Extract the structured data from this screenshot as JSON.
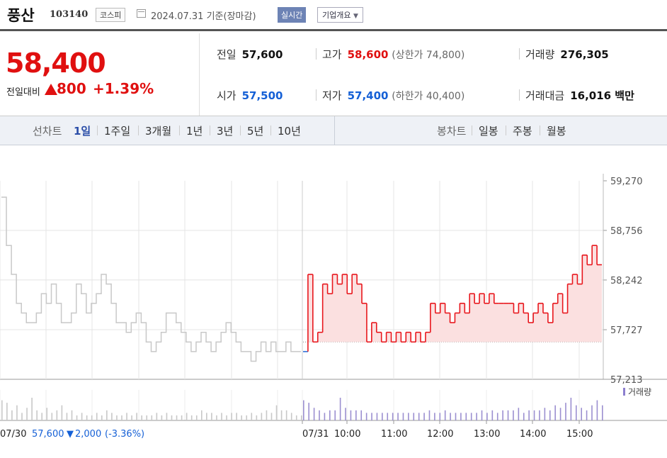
{
  "header": {
    "name": "풍산",
    "code": "103140",
    "market": "코스피",
    "date": "2024.07.31",
    "basis": "기준(장마감)",
    "realtime_btn": "실시간",
    "company_btn": "기업개요",
    "calendar_icon": "calendar-icon"
  },
  "price": {
    "current": "58,400",
    "diff_label": "전일대비",
    "diff_value": "800",
    "diff_pct": "+1.39%"
  },
  "stats": {
    "prev_label": "전일",
    "prev_value": "57,600",
    "open_label": "시가",
    "open_value": "57,500",
    "high_label": "고가",
    "high_value": "58,600",
    "upper_limit": "(상한가 74,800)",
    "low_label": "저가",
    "low_value": "57,400",
    "lower_limit": "(하한가 40,400)",
    "volume_label": "거래량",
    "volume_value": "276,305",
    "amount_label": "거래대금",
    "amount_value": "16,016 백만"
  },
  "periods": {
    "line_label": "선차트",
    "items": [
      "1일",
      "1주일",
      "3개월",
      "1년",
      "3년",
      "5년",
      "10년"
    ],
    "selected": "1일",
    "candle_label": "봉차트",
    "candle_items": [
      "일봉",
      "주봉",
      "월봉"
    ]
  },
  "chart_data": {
    "type": "line",
    "y_ticks": [
      "59,270",
      "58,756",
      "58,242",
      "57,727",
      "57,213"
    ],
    "ylim": [
      57213,
      59270
    ],
    "x_ticks": [
      "07/31",
      "10:00",
      "11:00",
      "12:00",
      "13:00",
      "14:00",
      "15:00"
    ],
    "baseline": 57600,
    "volume_legend": "거래량",
    "prev_day": {
      "date": "07/30",
      "close": "57,600",
      "change": "2,000",
      "change_pct": "(-3.36%)",
      "values": [
        59100,
        58600,
        58300,
        58000,
        57900,
        57800,
        57800,
        57900,
        58100,
        58000,
        58200,
        58000,
        57800,
        57800,
        57900,
        58200,
        58100,
        57900,
        58000,
        58100,
        58300,
        58200,
        58000,
        57800,
        57800,
        57700,
        57800,
        57900,
        57800,
        57600,
        57500,
        57600,
        57700,
        57900,
        57900,
        57800,
        57700,
        57600,
        57500,
        57600,
        57700,
        57600,
        57500,
        57600,
        57700,
        57800,
        57700,
        57600,
        57500,
        57500,
        57400,
        57500,
        57600,
        57500,
        57600,
        57500,
        57500,
        57600,
        57500,
        57500,
        57500
      ]
    },
    "series": [
      {
        "values": [
          57500,
          58300,
          57600,
          57700,
          58200,
          58100,
          58300,
          58200,
          58300,
          58100,
          58300,
          58200,
          58000,
          57600,
          57800,
          57700,
          57600,
          57700,
          57600,
          57700,
          57600,
          57700,
          57600,
          57700,
          57600,
          57700,
          58000,
          57900,
          58000,
          57900,
          57800,
          57900,
          58000,
          57900,
          58100,
          58000,
          58100,
          58000,
          58100,
          58000,
          58000,
          58000,
          58000,
          57900,
          58000,
          57900,
          57800,
          57900,
          58000,
          57900,
          57800,
          58000,
          58100,
          57900,
          58200,
          58300,
          58200,
          58500,
          58400,
          58600,
          58400,
          58400
        ]
      }
    ],
    "volume": [
      8,
      7,
      4,
      6,
      3,
      5,
      9,
      4,
      3,
      5,
      3,
      4,
      6,
      3,
      4,
      2,
      3,
      2,
      2,
      3,
      2,
      4,
      3,
      2,
      2,
      3,
      2,
      3,
      2,
      2,
      2,
      3,
      2,
      3,
      2,
      2,
      2,
      3,
      2,
      2,
      4,
      3,
      3,
      2,
      3,
      2,
      3,
      3,
      2,
      2,
      3,
      2,
      3,
      4,
      3,
      6,
      4,
      4,
      3,
      2,
      2,
      8,
      7,
      5,
      4,
      3,
      4,
      4,
      9,
      5,
      4,
      4,
      4,
      3,
      3,
      3,
      3,
      3,
      3,
      3,
      3,
      3,
      3,
      3,
      3,
      4,
      3,
      3,
      4,
      3,
      3,
      3,
      3,
      3,
      3,
      4,
      3,
      4,
      3,
      4,
      4,
      4,
      5,
      3,
      4,
      4,
      4,
      5,
      4,
      6,
      5,
      7,
      9,
      6,
      5,
      4,
      6,
      8,
      6
    ]
  }
}
